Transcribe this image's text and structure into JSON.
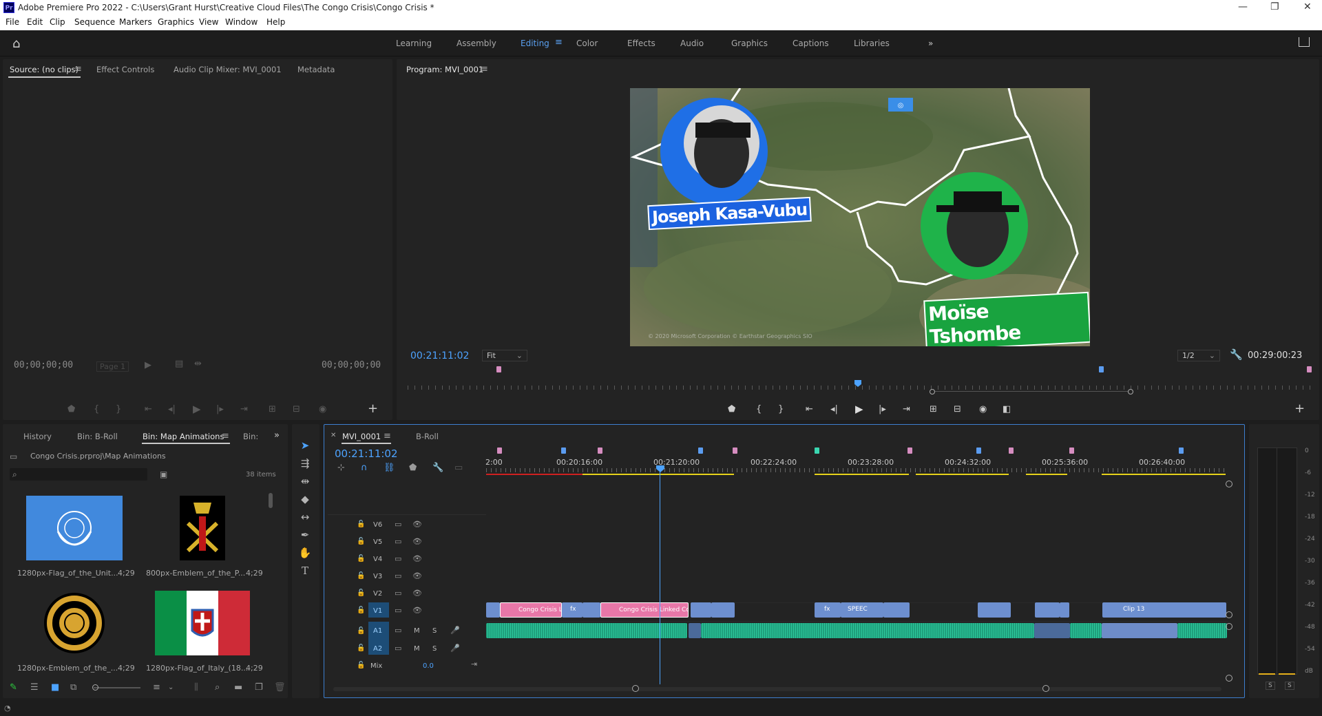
{
  "window": {
    "title": "Adobe Premiere Pro 2022 - C:\\Users\\Grant Hurst\\Creative Cloud Files\\The Congo Crisis\\Congo Crisis *",
    "app_icon": "Pr"
  },
  "menu": [
    "File",
    "Edit",
    "Clip",
    "Sequence",
    "Markers",
    "Graphics",
    "View",
    "Window",
    "Help"
  ],
  "workspaces": [
    "Learning",
    "Assembly",
    "Editing",
    "Color",
    "Effects",
    "Audio",
    "Graphics",
    "Captions",
    "Libraries"
  ],
  "active_workspace": "Editing",
  "source_panel": {
    "tabs": [
      "Source: (no clips)",
      "Effect Controls",
      "Audio Clip Mixer: MVI_0001",
      "Metadata"
    ],
    "timecode_left": "00;00;00;00",
    "timecode_right": "00;00;00;00",
    "page_select": "Page 1"
  },
  "program_panel": {
    "title": "Program: MVI_0001",
    "timecode": "00:21:11:02",
    "zoom": "Fit",
    "resolution": "1/2",
    "duration": "00:29:00:23",
    "video": {
      "name1": "Joseph Kasa-Vubu",
      "name2": "Moïse Tshombe",
      "credit": "© 2020 Microsoft Corporation © Earthstar Geographics SIO",
      "accent1": "#1f6fe6",
      "accent2": "#1fb34a"
    }
  },
  "project_panel": {
    "tabs": [
      "History",
      "Bin: B-Roll",
      "Bin: Map Animations",
      "Bin:"
    ],
    "path": "Congo Crisis.prproj\\Map Animations",
    "item_count": "38 items",
    "items": [
      {
        "name": "1280px-Flag_of_the_Unit...",
        "duration": "4;29"
      },
      {
        "name": "800px-Emblem_of_the_P...",
        "duration": "4;29"
      },
      {
        "name": "1280px-Emblem_of_the_...",
        "duration": "4;29"
      },
      {
        "name": "1280px-Flag_of_Italy_(18...",
        "duration": "4;29"
      }
    ]
  },
  "timeline": {
    "tabs": [
      "MVI_0001",
      "B-Roll"
    ],
    "timecode": "00:21:11:02",
    "ruler": [
      "2:00",
      "00:20:16:00",
      "00:21:20:00",
      "00:22:24:00",
      "00:23:28:00",
      "00:24:32:00",
      "00:25:36:00",
      "00:26:40:00"
    ],
    "video_tracks": [
      "V6",
      "V5",
      "V4",
      "V3",
      "V2",
      "V1"
    ],
    "audio_tracks": [
      "A1",
      "A2"
    ],
    "mix_label": "Mix",
    "mix_value": "0.0",
    "clips": {
      "c1": "Congo Crisis Li",
      "c2": "Congo Crisis Linked Co",
      "c3": "SPEEC",
      "c4": "Clip 13"
    },
    "track_buttons": {
      "mute": "M",
      "solo": "S"
    }
  },
  "meter": {
    "labels": [
      "0",
      "-6",
      "-12",
      "-18",
      "-24",
      "-30",
      "-36",
      "-42",
      "-48",
      "-54",
      "dB"
    ],
    "solo": [
      "S",
      "S"
    ]
  }
}
